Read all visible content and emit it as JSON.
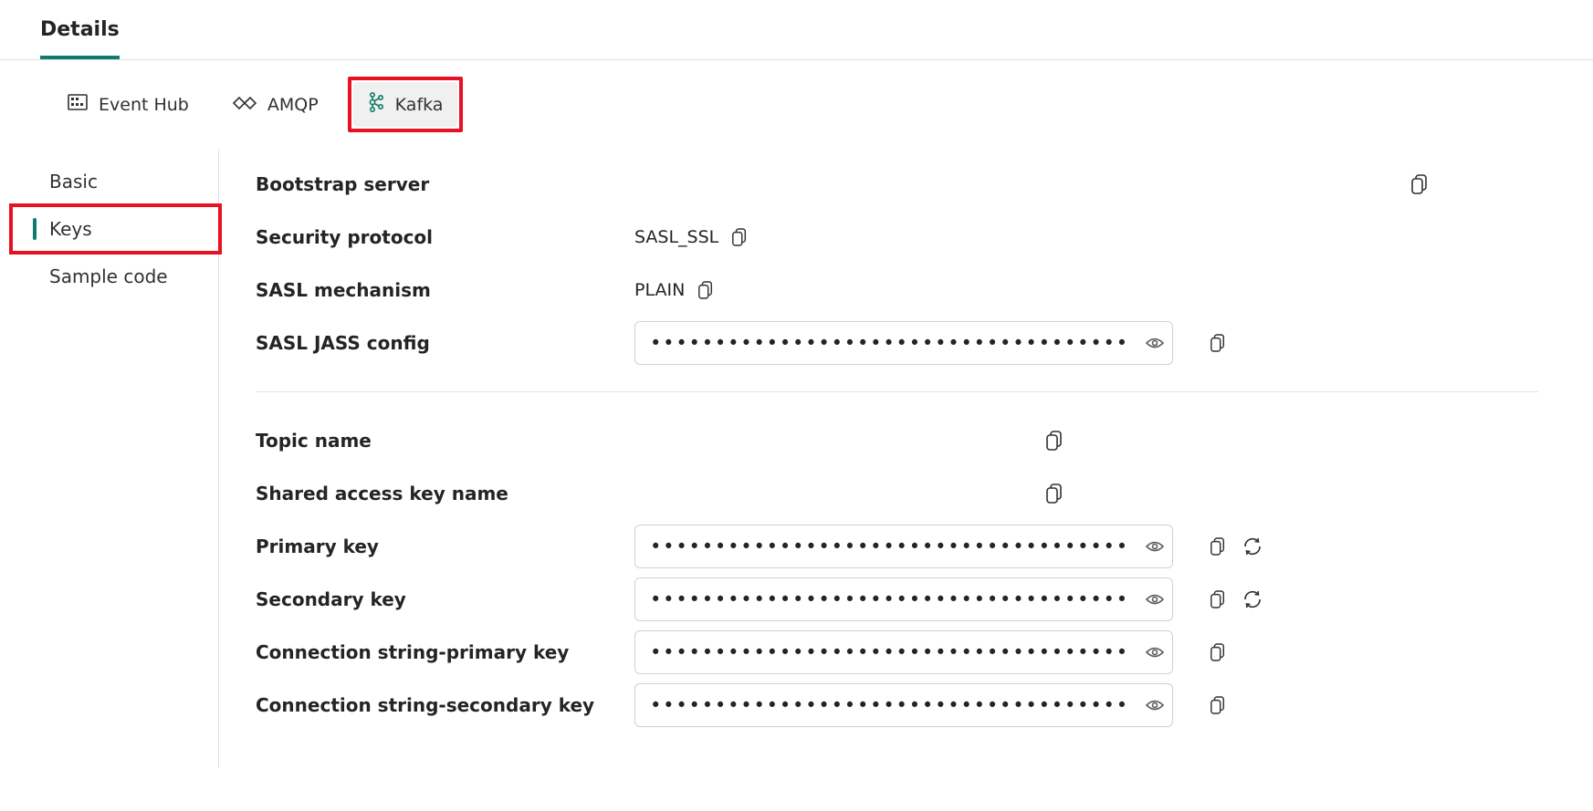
{
  "topTabs": {
    "details": "Details"
  },
  "protocolTabs": {
    "eventhub": "Event Hub",
    "amqp": "AMQP",
    "kafka": "Kafka"
  },
  "sidebar": {
    "basic": "Basic",
    "keys": "Keys",
    "sample": "Sample code"
  },
  "fields": {
    "bootstrap_label": "Bootstrap server",
    "bootstrap_value": "",
    "security_label": "Security protocol",
    "security_value": "SASL_SSL",
    "sasl_mech_label": "SASL mechanism",
    "sasl_mech_value": "PLAIN",
    "sasl_jass_label": "SASL JASS config",
    "topic_label": "Topic name",
    "topic_value": "",
    "shared_key_name_label": "Shared access key name",
    "shared_key_name_value": "",
    "primary_label": "Primary key",
    "secondary_label": "Secondary key",
    "conn_primary_label": "Connection string-primary key",
    "conn_secondary_label": "Connection string-secondary key"
  },
  "masked": "••••••••••••••••••••••••••••••••••••••••••••••••••••••••••••••••"
}
